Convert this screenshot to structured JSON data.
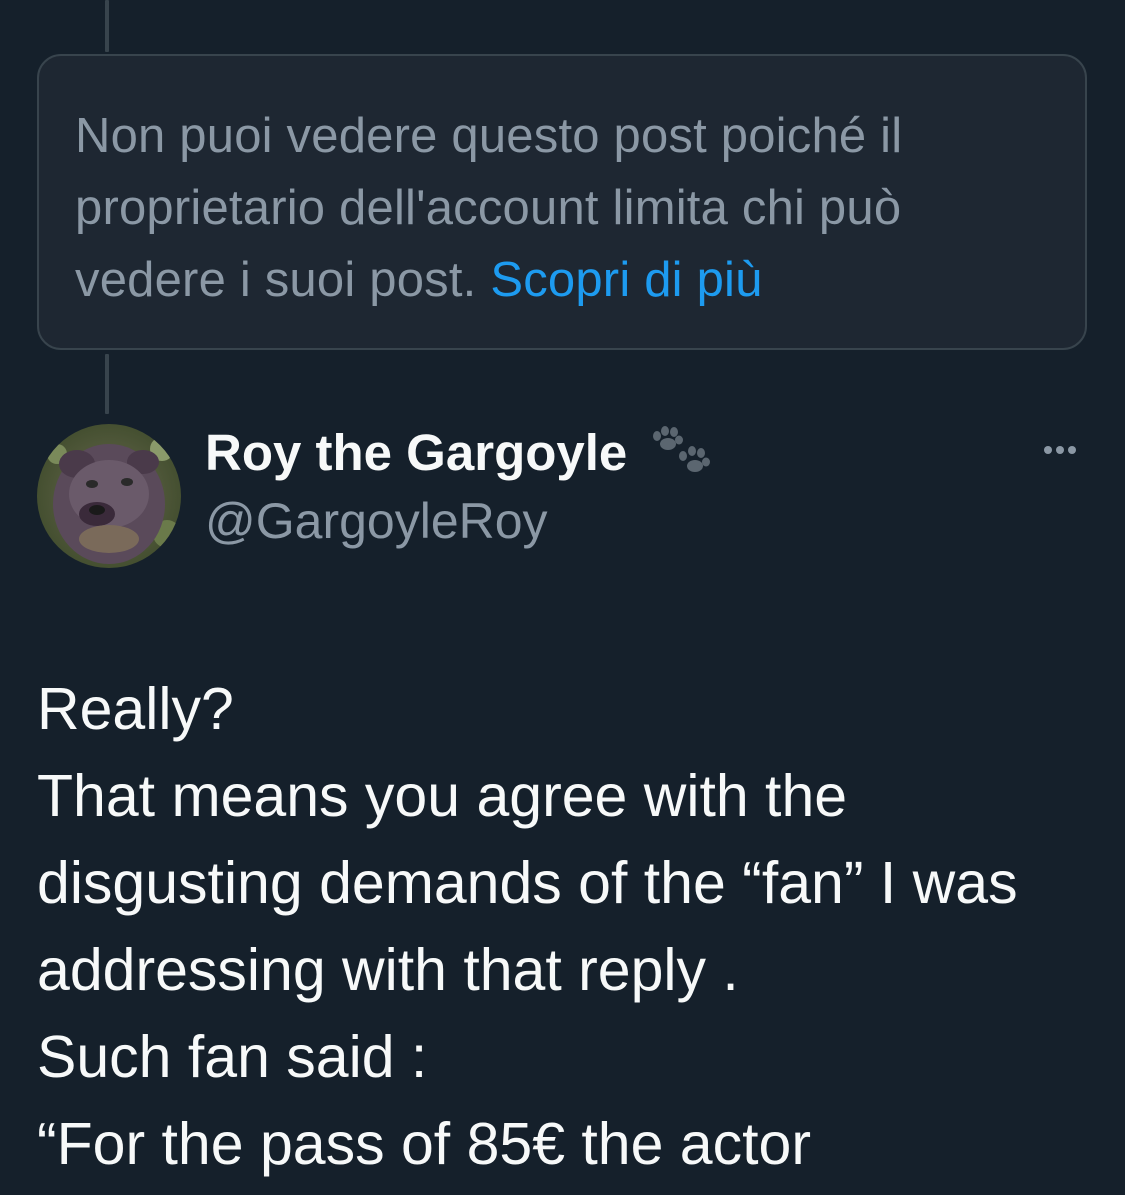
{
  "restricted_notice": {
    "message": "Non puoi vedere questo post poiché il proprietario dell'account limita chi può vedere i suoi post.",
    "learn_more_label": "Scopri di più"
  },
  "post": {
    "author_name": "Roy the Gargoyle",
    "author_handle": "@GargoyleRoy",
    "name_emoji": "paw-prints-icon",
    "text": "Really?\nThat means you agree with the disgusting demands of the “fan” I was addressing with that reply .\nSuch fan said :\n“For the pass of 85€ the actor"
  },
  "colors": {
    "background": "#15202b",
    "link": "#1d9bf0",
    "secondary_text": "#8b98a5",
    "primary_text": "#f7f9f9",
    "border": "#38444d"
  }
}
